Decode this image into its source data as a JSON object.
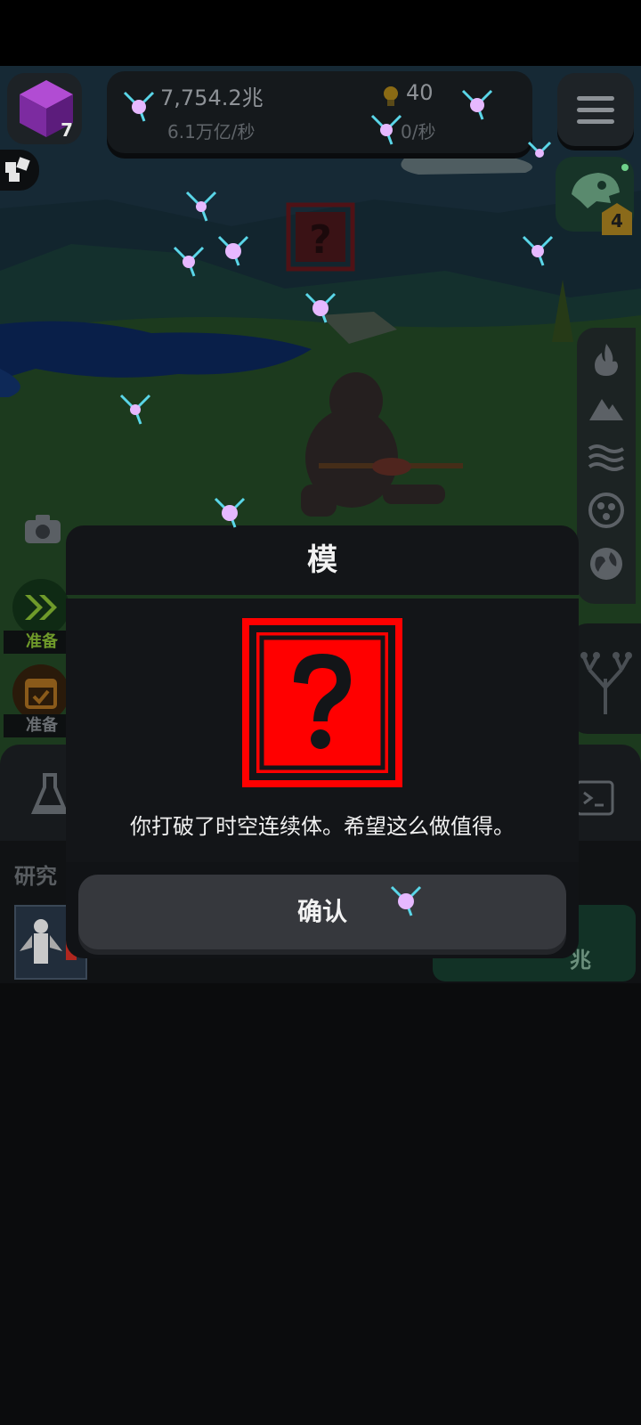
{
  "hud": {
    "cube_count": "7",
    "resource_amount": "7,754.2兆",
    "resource_rate": "6.1万亿/秒",
    "idea_amount": "40",
    "idea_rate": "0/秒",
    "dino_badge": "4"
  },
  "left_buttons": {
    "ready_1_label": "准备",
    "ready_2_label": "准备"
  },
  "side_icons": [
    "fire-icon",
    "mountain-icon",
    "waves-icon",
    "cell-icon",
    "globe-icon"
  ],
  "research": {
    "label": "研究",
    "price_suffix": "兆"
  },
  "modal": {
    "title": "模",
    "message": "你打破了时空连续体。希望这么做值得。",
    "confirm_label": "确认"
  },
  "colors": {
    "question_red": "#ff0000",
    "accent_green": "#6f9a2a",
    "badge_gold": "#8a6a1a"
  }
}
